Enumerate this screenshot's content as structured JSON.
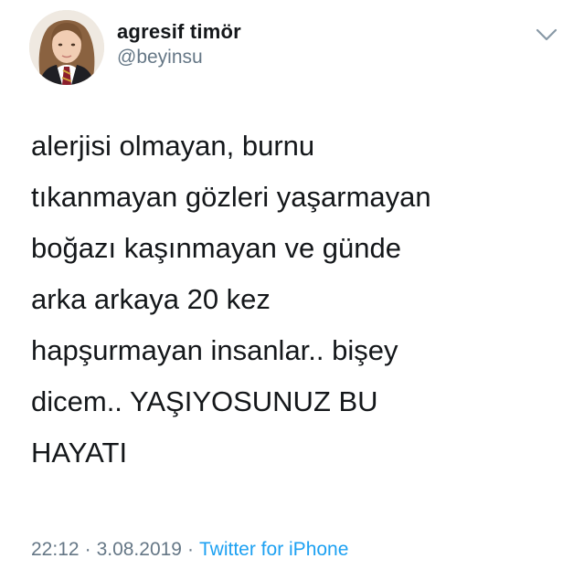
{
  "tweet": {
    "display_name": "agresif timör",
    "handle": "@beyinsu",
    "lines": [
      "alerjisi olmayan, burnu",
      "tıkanmayan gözleri yaşarmayan",
      "boğazı kaşınmayan ve günde",
      "arka arkaya 20 kez",
      "hapşurmayan insanlar.. bişey",
      "dicem.. YAŞIYOSUNUZ BU",
      "HAYATI"
    ],
    "time": "22:12",
    "separator": "·",
    "date": "3.08.2019",
    "source": "Twitter for iPhone"
  },
  "icons": {
    "more": "chevron-down-icon"
  },
  "colors": {
    "text": "#14171a",
    "secondary": "#657786",
    "link": "#1da1f2"
  }
}
